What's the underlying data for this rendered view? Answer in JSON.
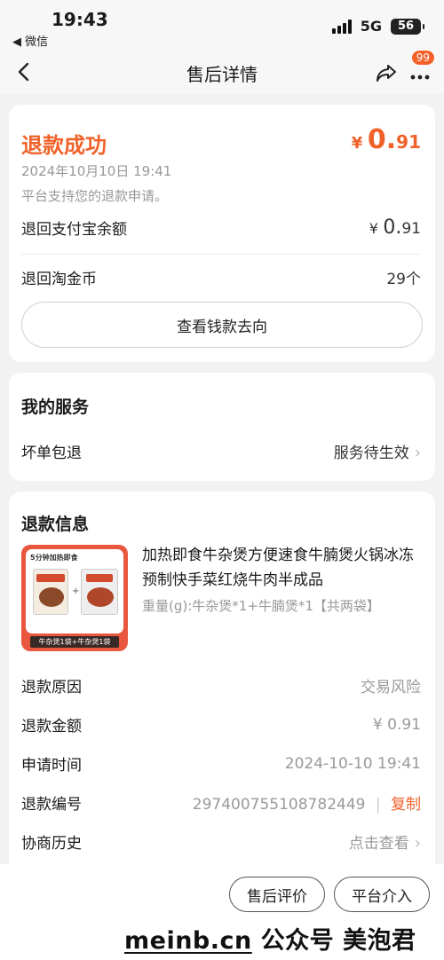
{
  "status_bar": {
    "time": "19:43",
    "back_app": "◀ 微信",
    "network": "5G",
    "battery": "56"
  },
  "nav": {
    "title": "售后详情",
    "badge": "99"
  },
  "refund": {
    "status": "退款成功",
    "amount_currency": "¥",
    "amount_int": "0.",
    "amount_dec": "91",
    "time": "2024年10月10日 19:41",
    "note": "平台支持您的退款申请。",
    "alipay_label": "退回支付宝余额",
    "alipay_currency": "¥",
    "alipay_int": "0.",
    "alipay_dec": "91",
    "coins_label": "退回淘金币",
    "coins_value": "29个",
    "track_button": "查看钱款去向"
  },
  "service": {
    "title": "我的服务",
    "item_label": "坏单包退",
    "item_value": "服务待生效"
  },
  "refund_info": {
    "title": "退款信息",
    "product": {
      "image_header": "5分钟加热即食",
      "image_footer": "牛杂煲1袋+牛杂煲1袋",
      "title": "加热即食牛杂煲方便速食牛腩煲火锅冰冻预制快手菜红烧牛肉半成品",
      "spec": "重量(g):牛杂煲*1+牛腩煲*1【共两袋】"
    },
    "reason_label": "退款原因",
    "reason_value": "交易风险",
    "amount_label": "退款金额",
    "amount_value": "¥ 0.91",
    "apply_time_label": "申请时间",
    "apply_time_value": "2024-10-10 19:41",
    "number_label": "退款编号",
    "number_value": "297400755108782449",
    "copy_label": "复制",
    "history_label": "协商历史",
    "history_value": "点击查看"
  },
  "bottom": {
    "review_button": "售后评价",
    "intervene_button": "平台介入",
    "watermark_site": "meinb.cn",
    "watermark_text": "公众号 美泡君"
  },
  "colors": {
    "accent": "#f0622a",
    "muted": "#999999",
    "background": "#f2f2f2"
  },
  "icons": [
    "back-arrow-icon",
    "share-icon",
    "more-icon",
    "chevron-right-icon",
    "signal-icon",
    "battery-icon"
  ]
}
